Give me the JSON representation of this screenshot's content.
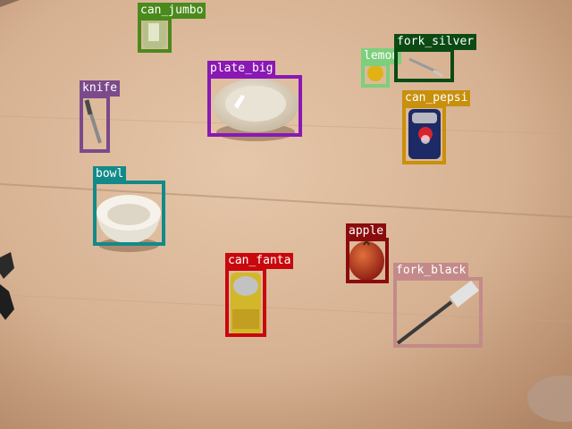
{
  "detections": [
    {
      "id": "can_jumbo",
      "label": "can_jumbo",
      "color": "#4a8a1c"
    },
    {
      "id": "plate_big",
      "label": "plate_big",
      "color": "#8a18b4"
    },
    {
      "id": "lemon",
      "label": "lemon",
      "color": "#7dcf7d"
    },
    {
      "id": "fork_silver",
      "label": "fork_silver",
      "color": "#0c4a14"
    },
    {
      "id": "knife",
      "label": "knife",
      "color": "#7a4a8a"
    },
    {
      "id": "can_pepsi",
      "label": "can_pepsi",
      "color": "#c8900c"
    },
    {
      "id": "bowl",
      "label": "bowl",
      "color": "#128a8a"
    },
    {
      "id": "apple",
      "label": "apple",
      "color": "#8a0c0c"
    },
    {
      "id": "can_fanta",
      "label": "can_fanta",
      "color": "#c8080c"
    },
    {
      "id": "fork_black",
      "label": "fork_black",
      "color": "#c48a8a"
    }
  ]
}
